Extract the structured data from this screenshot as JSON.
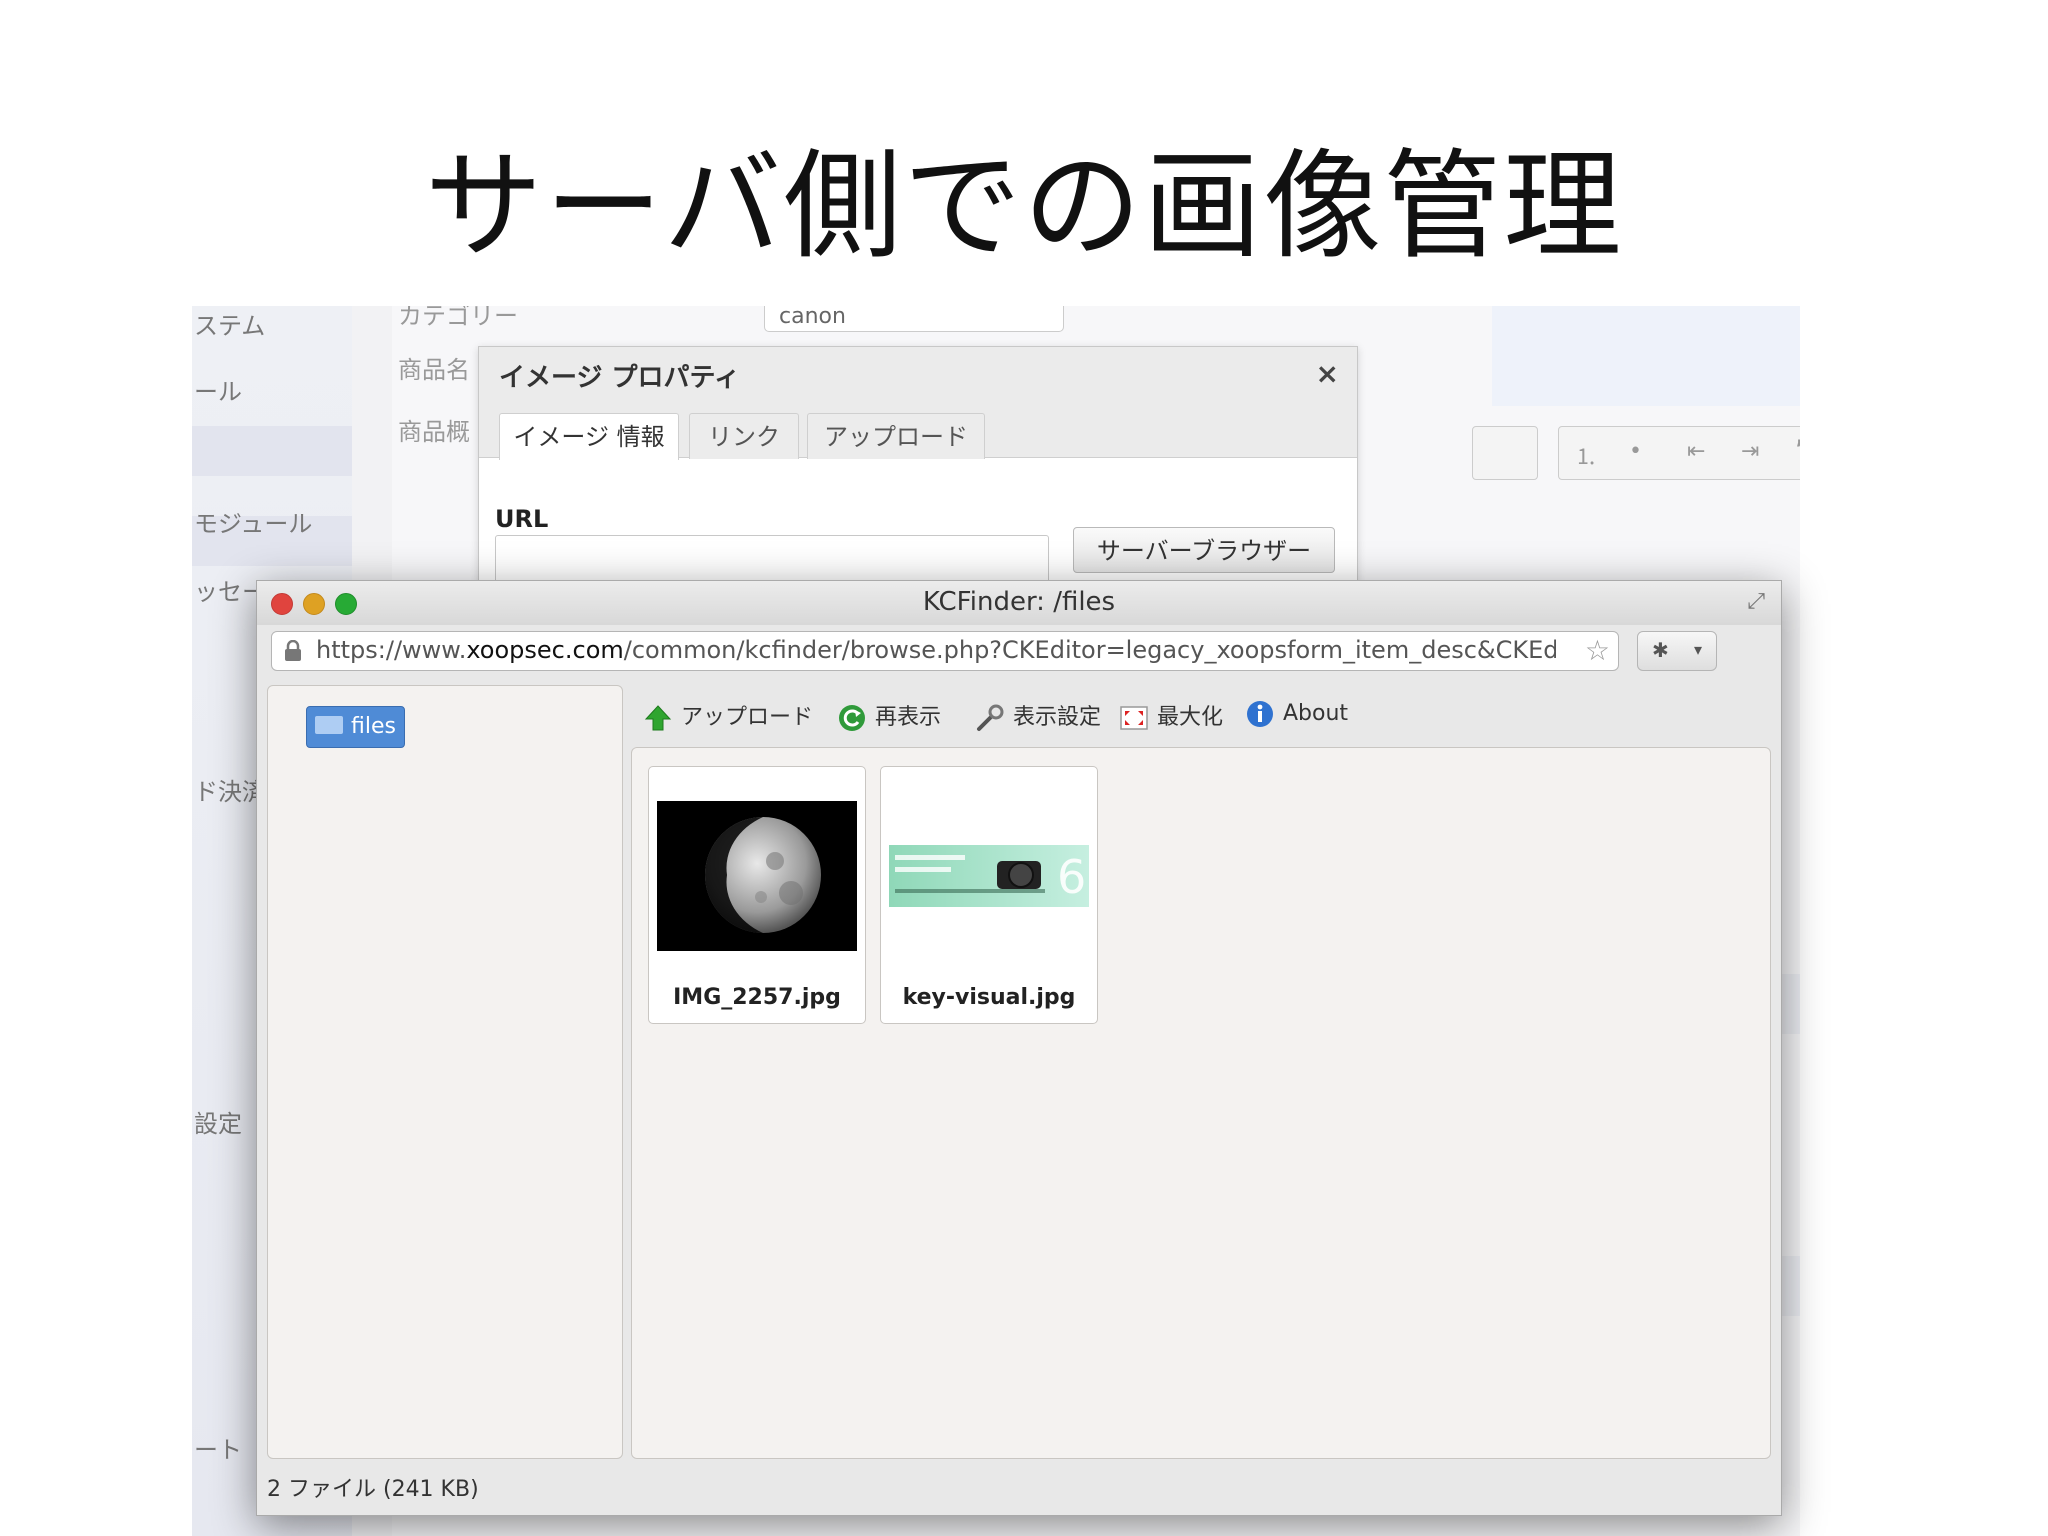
{
  "slide": {
    "title": "サーバ側での画像管理"
  },
  "background": {
    "sidebar_items": [
      "ステム",
      "ール",
      "モジュール",
      "ッセー",
      "ド決済",
      "設定",
      "ート"
    ],
    "form_labels": [
      "カテゴリー",
      "商品名",
      "商品概"
    ],
    "category_value": "canon"
  },
  "image_dialog": {
    "title": "イメージ プロパティ",
    "close": "×",
    "tabs": [
      "イメージ 情報",
      "リンク",
      "アップロード"
    ],
    "url_label": "URL",
    "server_browser_button": "サーバーブラウザー"
  },
  "kcfinder": {
    "window_title": "KCFinder: /files",
    "url_prefix": "https://www.",
    "url_host": "xoopsec.com",
    "url_path": "/common/kcfinder/browse.php?CKEditor=legacy_xoopsform_item_desc&CKEdit",
    "folder": "files",
    "toolbar": {
      "upload": "アップロード",
      "refresh": "再表示",
      "settings": "表示設定",
      "maximize": "最大化",
      "about": "About"
    },
    "files": [
      {
        "name": "IMG_2257.jpg"
      },
      {
        "name": "key-visual.jpg"
      }
    ],
    "status": "2 ファイル (241 KB)"
  },
  "colors": {
    "folder_selected": "#4f8bd6",
    "close_red": "#e0443e",
    "minimize_yellow": "#dea123",
    "zoom_green": "#27aa35"
  }
}
